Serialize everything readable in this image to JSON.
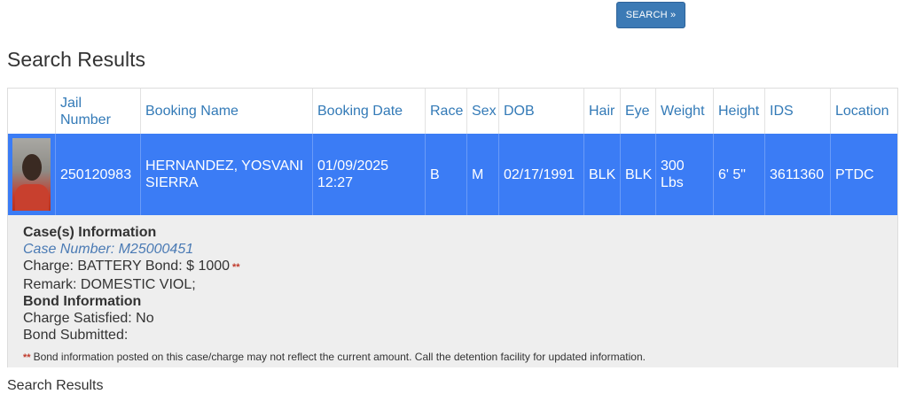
{
  "search_button": {
    "label": "SEARCH »"
  },
  "page": {
    "title": "Search Results"
  },
  "table": {
    "columns": [
      "",
      "Jail Number",
      "Booking Name",
      "Booking Date",
      "Race",
      "Sex",
      "DOB",
      "Hair",
      "Eye",
      "Weight",
      "Height",
      "IDS",
      "Location"
    ],
    "rows": [
      {
        "jail_number": "250120983",
        "booking_name": "HERNANDEZ, YOSVANI SIERRA",
        "booking_date": "01/09/2025 12:27",
        "race": "B",
        "sex": "M",
        "dob": "02/17/1991",
        "hair": "BLK",
        "eye": "BLK",
        "weight": "300 Lbs",
        "height": "6' 5\"",
        "ids": "3611360",
        "location": "PTDC"
      }
    ]
  },
  "details": {
    "cases_heading": "Case(s) Information",
    "case_number": "Case Number: M25000451",
    "charge": "Charge: BATTERY Bond: $ 1000",
    "asterisks": "**",
    "remark": "Remark: DOMESTIC VIOL;",
    "bond_heading": "Bond Information",
    "charge_satisfied": "Charge Satisfied: No",
    "bond_submitted": "Bond Submitted:",
    "note": "Bond information posted on this case/charge may not reflect the current amount. Call the detention facility for updated information."
  },
  "footer": {
    "cut_text": "Search Results"
  },
  "colors": {
    "accent": "#337ab7",
    "row_highlight": "#3b7cf5",
    "button": "#3c7ab5",
    "details_bg": "#eeeeee"
  }
}
